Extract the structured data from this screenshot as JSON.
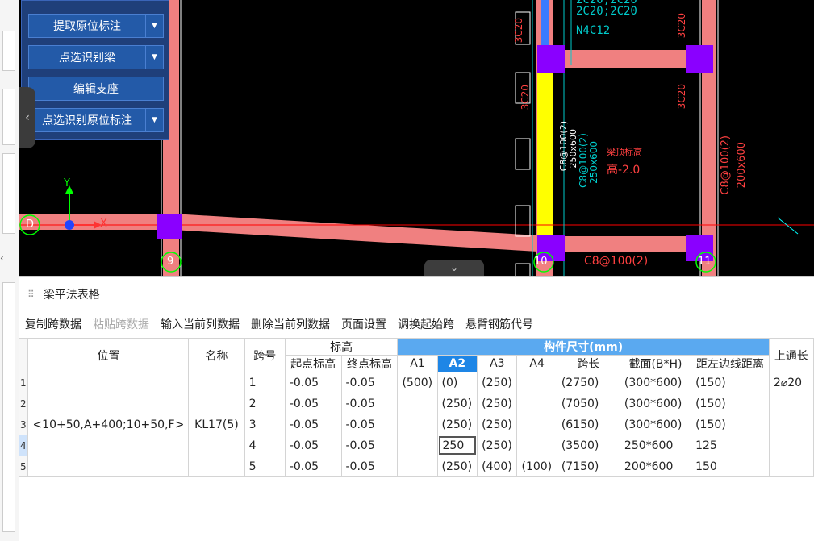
{
  "cad": {
    "buttons": [
      {
        "label": "提取原位标注",
        "dropdown": true
      },
      {
        "label": "点选识别梁",
        "dropdown": true
      },
      {
        "label": "编辑支座",
        "dropdown": false
      },
      {
        "label": "点选识别原位标注",
        "dropdown": true
      }
    ],
    "panel_toggle_icon": "chevron-left",
    "collapse_icon": "chevron-down",
    "axis_labels": {
      "y": "Y",
      "x": "X"
    },
    "grid_labels": {
      "d": "D",
      "g9": "9",
      "g10": "10",
      "g11": "11"
    },
    "annotations": {
      "top1": "2C20;2C20",
      "top2": "N4C12",
      "top0": "2C20;2C20",
      "left_3c20": "3C20",
      "mid_3c20": "3C20",
      "right_3c20_top": "3C20",
      "right_3c20": "3C20",
      "vert_beam_1": "C8@100(2)",
      "vert_beam_2": "250x600",
      "vert_beam_3": "C8@100(2)",
      "vert_beam_4": "250x600",
      "red_note_1": "梁顶标高",
      "red_note_2": "高-2.0",
      "right_vert_1": "C8@100(2)",
      "right_vert_2": "200x600",
      "bottom_label": "C8@100(2)"
    },
    "colors": {
      "beam": "#f08080",
      "column": "#8a00ff",
      "highlight": "#ffff00",
      "grid": "#ff0000"
    }
  },
  "panel": {
    "title": "梁平法表格",
    "toolbar": [
      {
        "label": "复制跨数据",
        "enabled": true
      },
      {
        "label": "粘贴跨数据",
        "enabled": false
      },
      {
        "label": "输入当前列数据",
        "enabled": true
      },
      {
        "label": "删除当前列数据",
        "enabled": true
      },
      {
        "label": "页面设置",
        "enabled": true
      },
      {
        "label": "调换起始跨",
        "enabled": true
      },
      {
        "label": "悬臂钢筋代号",
        "enabled": true
      }
    ]
  },
  "table": {
    "headers": {
      "position": "位置",
      "name": "名称",
      "span_no": "跨号",
      "elevation": "标高",
      "start_elev": "起点标高",
      "end_elev": "终点标高",
      "component_size": "构件尺寸(mm)",
      "a1": "A1",
      "a2": "A2",
      "a3": "A3",
      "a4": "A4",
      "span_len": "跨长",
      "section": "截面(B*H)",
      "dist_left": "距左边线距离",
      "top_through": "上通长"
    },
    "position": "<10+50,A+400;10+50,F>",
    "name": "KL17(5)",
    "rows": [
      {
        "rn": "1",
        "span": "1",
        "start": "-0.05",
        "end": "-0.05",
        "a1": "(500)",
        "a2": "(0)",
        "a3": "(250)",
        "a4": "",
        "len": "(2750)",
        "sec": "(300*600)",
        "dist": "(150)",
        "top": "2⌀20"
      },
      {
        "rn": "2",
        "span": "2",
        "start": "-0.05",
        "end": "-0.05",
        "a1": "",
        "a2": "(250)",
        "a3": "(250)",
        "a4": "",
        "len": "(7050)",
        "sec": "(300*600)",
        "dist": "(150)",
        "top": ""
      },
      {
        "rn": "3",
        "span": "3",
        "start": "-0.05",
        "end": "-0.05",
        "a1": "",
        "a2": "(250)",
        "a3": "(250)",
        "a4": "",
        "len": "(6150)",
        "sec": "(300*600)",
        "dist": "(150)",
        "top": ""
      },
      {
        "rn": "4",
        "span": "4",
        "start": "-0.05",
        "end": "-0.05",
        "a1": "",
        "a2": "250",
        "a3": "(250)",
        "a4": "",
        "len": "(3500)",
        "sec": "250*600",
        "dist": "125",
        "top": ""
      },
      {
        "rn": "5",
        "span": "5",
        "start": "-0.05",
        "end": "-0.05",
        "a1": "",
        "a2": "(250)",
        "a3": "(400)",
        "a4": "(100)",
        "len": "(7150)",
        "sec": "200*600",
        "dist": "150",
        "top": ""
      }
    ]
  }
}
